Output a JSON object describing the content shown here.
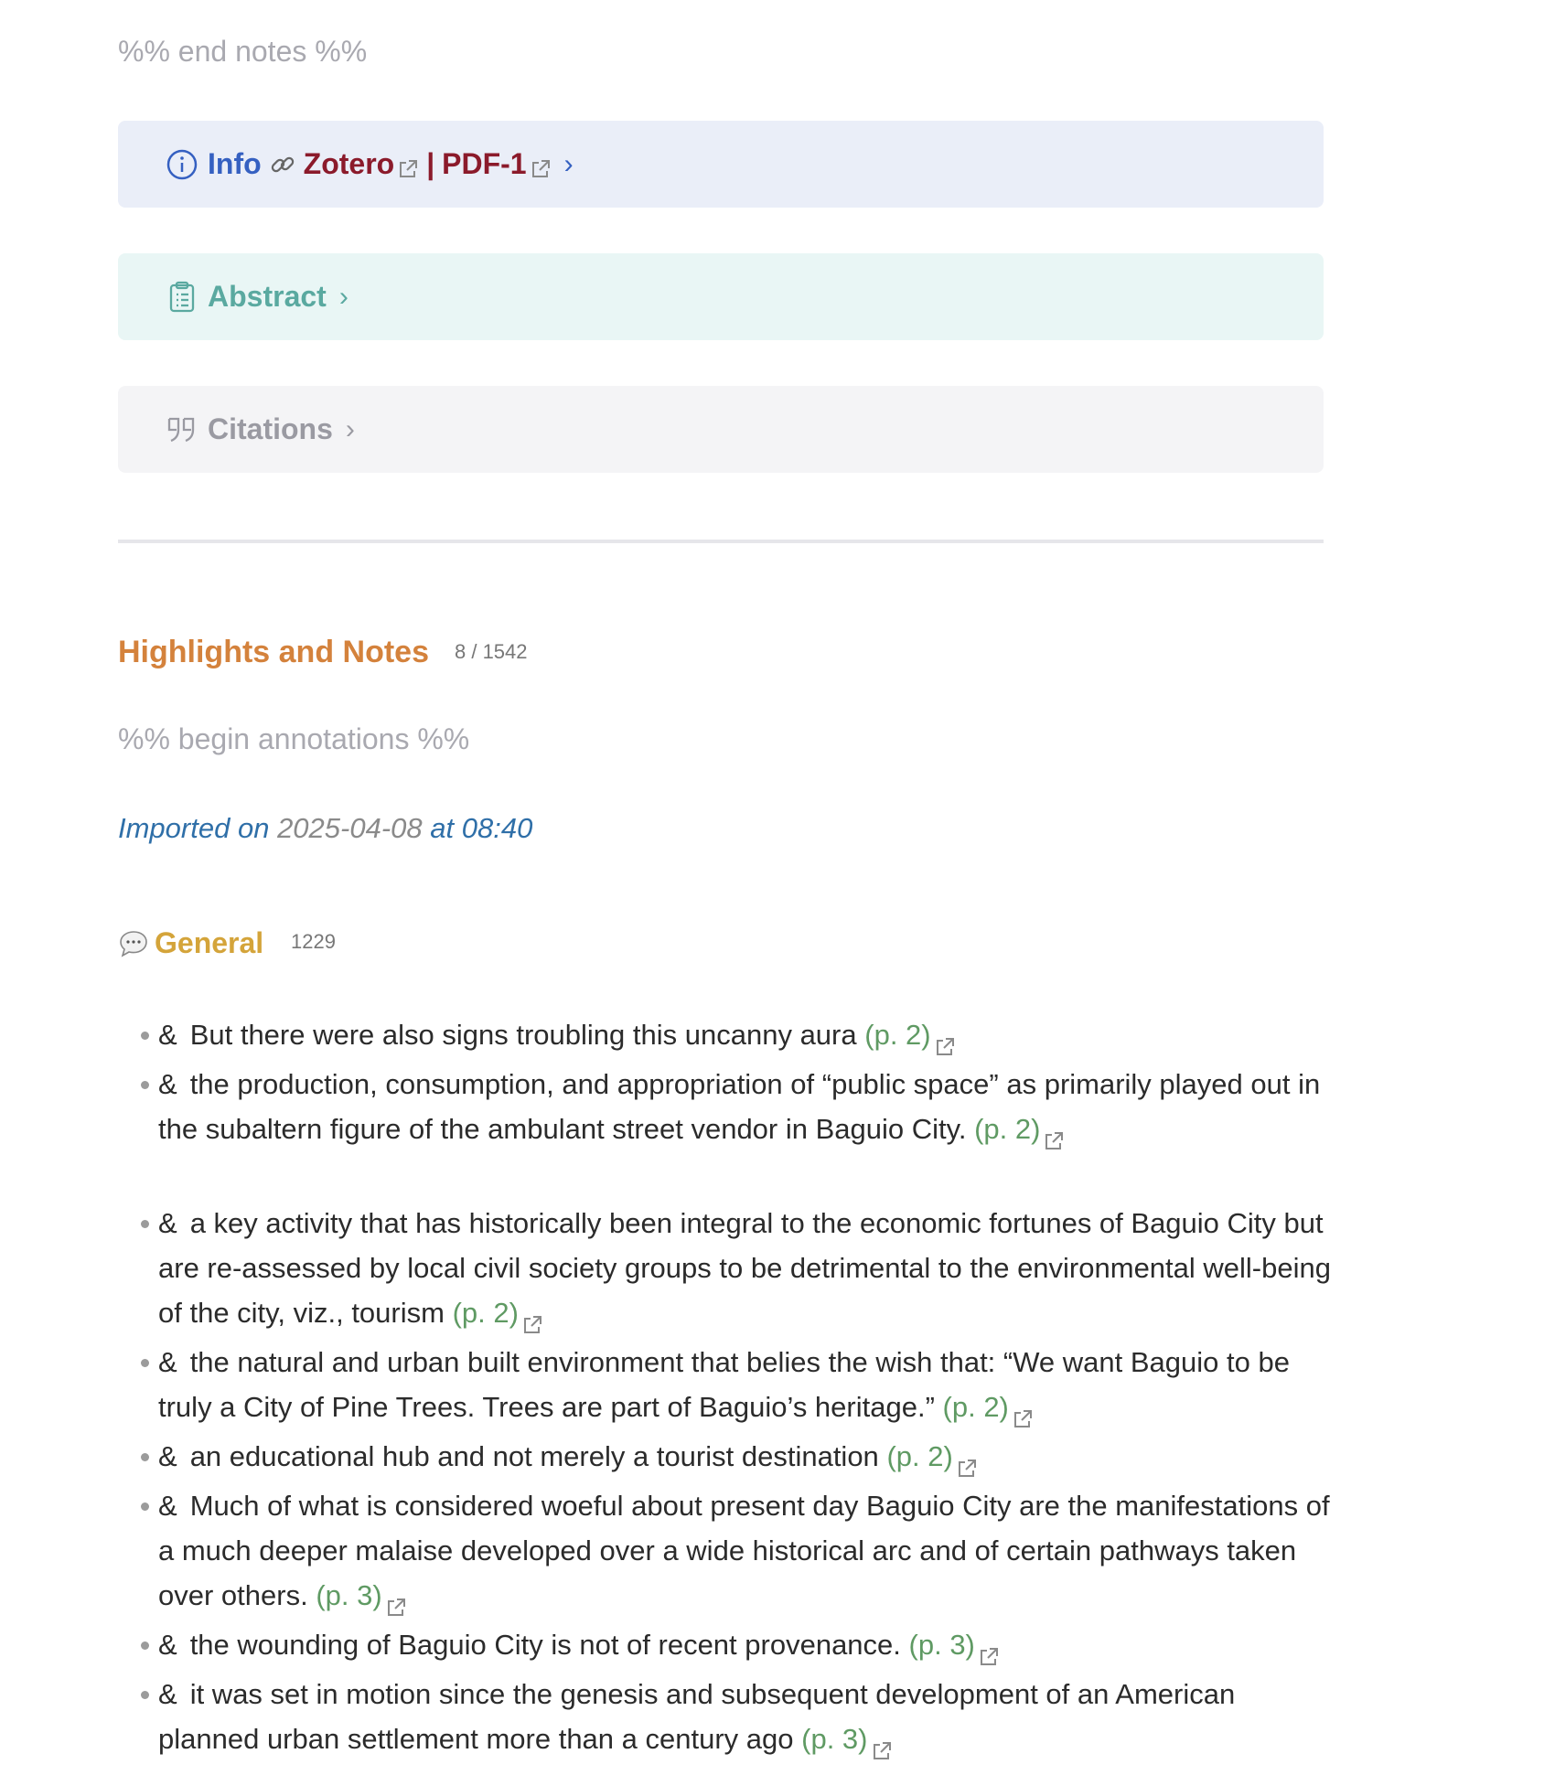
{
  "end_notes_comment": "%% end notes %%",
  "info_callout": {
    "title": "Info",
    "zotero_label": "Zotero",
    "separator": "|",
    "pdf_label": "PDF-1"
  },
  "abstract_callout": {
    "title": "Abstract"
  },
  "citations_callout": {
    "title": "Citations"
  },
  "highlights": {
    "heading": "Highlights and Notes",
    "count": "8 / 1542"
  },
  "begin_annotations_comment": "%% begin annotations %%",
  "imported": {
    "prefix": "Imported on",
    "date": "2025-04-08",
    "middle": "at",
    "time": "08:40"
  },
  "general": {
    "label": "General",
    "count": "1229"
  },
  "notes": [
    {
      "text": "But there were also signs troubling this uncanny aura",
      "page": "(p. 2)"
    },
    {
      "text": "the production, consumption, and appropriation of “public space” as primarily played out in the subaltern figure of the ambulant street vendor in Baguio City.",
      "page": "(p. 2)"
    },
    {
      "text": "a key activity that has historically been integral to the economic fortunes of Baguio City but are re-assessed by local civil society groups to be detrimental to the environmental well-being of the city, viz., tourism",
      "page": "(p. 2)"
    },
    {
      "text": "the natural and urban built environment that belies the wish that: “We want Baguio to be truly a City of Pine Trees. Trees are part of Baguio’s heritage.”",
      "page": "(p. 2)"
    },
    {
      "text": "an educational hub and not merely a tourist destination",
      "page": "(p. 2)"
    },
    {
      "text": "Much of what is considered woeful about present day Baguio City are the manifestations of a much deeper malaise developed over a wide historical arc and of certain pathways taken over others.",
      "page": "(p. 3)"
    },
    {
      "text": "the wounding of Baguio City is not of recent provenance.",
      "page": "(p. 3)"
    },
    {
      "text": "it was set in motion since the genesis and subsequent development of an American planned urban settlement more than a century ago",
      "page": "(p. 3)"
    }
  ],
  "amp_symbol": "&",
  "colors": {
    "info": "#3560c1",
    "zotero": "#8b1a2b",
    "abstract": "#5aa9a0",
    "citations": "#9a9aa2",
    "highlights": "#d4823c",
    "general": "#d4a43a",
    "page_link": "#5f9a63"
  }
}
